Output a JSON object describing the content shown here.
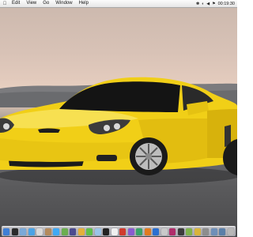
{
  "menubar": {
    "apple_icon": "apple-logo-icon",
    "items": [
      "Edit",
      "View",
      "Go",
      "Window",
      "Help"
    ],
    "clock": "00:19:30",
    "tray_icons": [
      "bluetooth-icon",
      "wifi-icon",
      "volume-icon",
      "flag-icon"
    ]
  },
  "wallpaper": {
    "subject": "yellow sports car",
    "car_color": "#f2d21a"
  },
  "dock": {
    "icons": [
      {
        "name": "finder-icon",
        "color": "#3f7fd6"
      },
      {
        "name": "dashboard-icon",
        "color": "#2b2b2b"
      },
      {
        "name": "mail-icon",
        "color": "#7aa9d8"
      },
      {
        "name": "safari-icon",
        "color": "#4aa3e6"
      },
      {
        "name": "ical-icon",
        "color": "#d9d9d9"
      },
      {
        "name": "address-book-icon",
        "color": "#b48a5c"
      },
      {
        "name": "itunes-icon",
        "color": "#3fa9f5"
      },
      {
        "name": "iphoto-icon",
        "color": "#6cae4f"
      },
      {
        "name": "imovie-icon",
        "color": "#4b4b8f"
      },
      {
        "name": "garageband-icon",
        "color": "#e4b03a"
      },
      {
        "name": "ichat-icon",
        "color": "#5fbf4a"
      },
      {
        "name": "preview-icon",
        "color": "#9bc4e8"
      },
      {
        "name": "terminal-icon",
        "color": "#222222"
      },
      {
        "name": "textedit-icon",
        "color": "#f0f0f0"
      },
      {
        "name": "app-icon-1",
        "color": "#d03a2e"
      },
      {
        "name": "app-icon-2",
        "color": "#8a5bd0"
      },
      {
        "name": "app-icon-3",
        "color": "#39a36b"
      },
      {
        "name": "app-icon-4",
        "color": "#e07b20"
      },
      {
        "name": "app-icon-5",
        "color": "#2a6fd1"
      },
      {
        "name": "app-icon-6",
        "color": "#c9c9c9"
      },
      {
        "name": "app-icon-7",
        "color": "#b02d6a"
      },
      {
        "name": "app-icon-8",
        "color": "#3c3c3c"
      },
      {
        "name": "app-icon-9",
        "color": "#7fb34c"
      },
      {
        "name": "app-icon-10",
        "color": "#d8b43c"
      },
      {
        "name": "system-preferences-icon",
        "color": "#8d8d8d"
      },
      {
        "name": "documents-stack-icon",
        "color": "#6f8fb8"
      },
      {
        "name": "downloads-stack-icon",
        "color": "#5b7fa8"
      },
      {
        "name": "trash-icon",
        "color": "#b7b7b7"
      }
    ]
  }
}
